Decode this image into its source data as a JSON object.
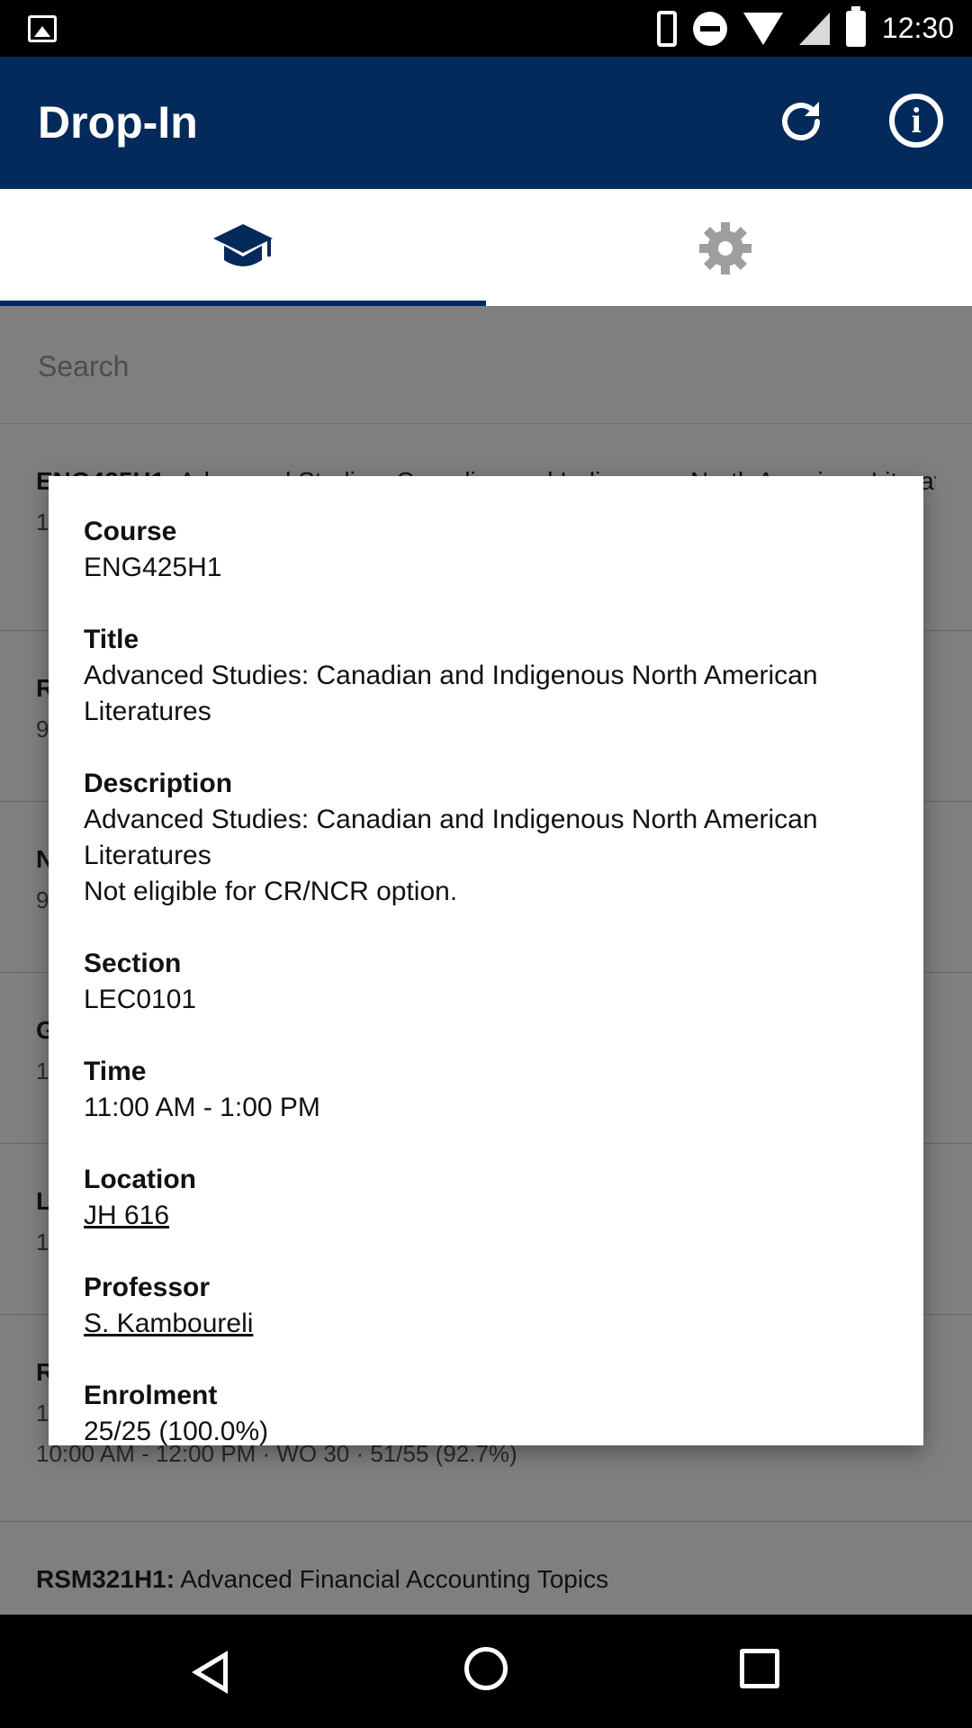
{
  "status_bar": {
    "time": "12:30"
  },
  "app_bar": {
    "title": "Drop-In"
  },
  "tabs": [
    {
      "icon": "graduation-cap-icon",
      "selected": true
    },
    {
      "icon": "gear-icon",
      "selected": false
    }
  ],
  "search": {
    "placeholder": "Search"
  },
  "list": {
    "items": [
      {
        "code": "ENG425H1:",
        "title": "Advanced Studies: Canadian and Indigenous North American Literatures",
        "line2": "",
        "line3": "1"
      },
      {
        "code": "R",
        "title": "",
        "line2": "9",
        "line3": ""
      },
      {
        "code": "N",
        "title": "",
        "line2": "9",
        "line3": ""
      },
      {
        "code": "G",
        "title": "",
        "line2": "1",
        "line3": ""
      },
      {
        "code": "L",
        "title": "",
        "line2": "1",
        "line3": ""
      },
      {
        "code": "R",
        "title": "",
        "line2": "1",
        "line3": "10:00 AM - 12:00 PM · WO 30 · 51/55 (92.7%)"
      },
      {
        "code": "RSM321H1:",
        "title": "Advanced Financial Accounting Topics",
        "line2": "",
        "line3": ""
      }
    ]
  },
  "dialog": {
    "course_label": "Course",
    "course_value": "ENG425H1",
    "title_label": "Title",
    "title_value": "Advanced Studies: Canadian and Indigenous North American Literatures",
    "description_label": "Description",
    "description_value": "Advanced Studies: Canadian and Indigenous North American Literatures\nNot eligible for CR/NCR option.",
    "section_label": "Section",
    "section_value": "LEC0101",
    "time_label": "Time",
    "time_value": "11:00 AM - 1:00 PM",
    "location_label": "Location",
    "location_value": "JH 616",
    "professor_label": "Professor",
    "professor_value": "S. Kamboureli",
    "enrolment_label": "Enrolment",
    "enrolment_value": "25/25 (100.0%)"
  },
  "colors": {
    "primary": "#032a5a",
    "scrim": "rgba(0,0,0,0.5)"
  }
}
